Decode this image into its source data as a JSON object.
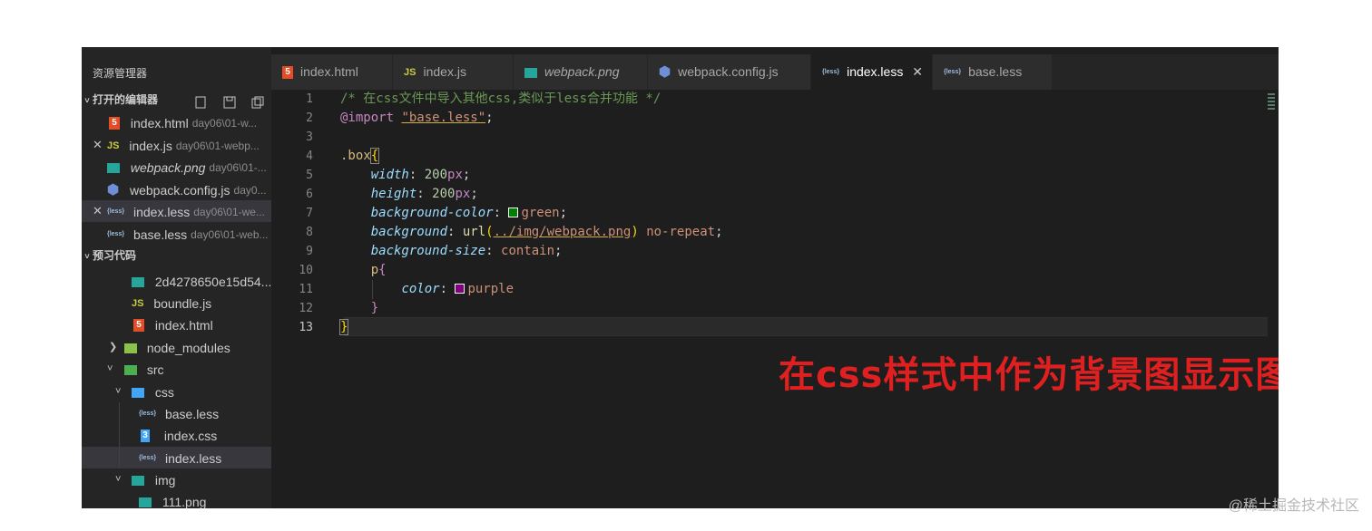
{
  "colors": {
    "html": "#e44d26",
    "js": "#cbcb41",
    "img": "#a074c4",
    "config": "#6d8fd5",
    "less": "#9cbde0",
    "css": "#42a5f5",
    "folder": "#8bc34a",
    "folder_src": "#4caf50",
    "folder_css": "#42a5f5",
    "overlay": "#e02020"
  },
  "sidebar": {
    "title": "资源管理器",
    "open_editors": {
      "header": "打开的编辑器",
      "items": [
        {
          "icon": "html-file-icon",
          "glyph": "5",
          "name": "index.html",
          "path": "day06\\01-w..."
        },
        {
          "icon": "js-file-icon",
          "glyph": "JS",
          "name": "index.js",
          "path": "day06\\01-webp..."
        },
        {
          "icon": "image-file-icon",
          "glyph": "▣",
          "name": "webpack.png",
          "path": "day06\\01-..."
        },
        {
          "icon": "webpack-config-icon",
          "glyph": "⬢",
          "name": "webpack.config.js",
          "path": "day0..."
        },
        {
          "icon": "less-file-icon",
          "glyph": "{less}",
          "name": "index.less",
          "path": "day06\\01-we..."
        },
        {
          "icon": "less-file-icon",
          "glyph": "{less}",
          "name": "base.less",
          "path": "day06\\01-web..."
        }
      ]
    },
    "project": {
      "header": "预习代码",
      "items": [
        {
          "icon": "image-file-icon",
          "name": "2d4278650e15d54..."
        },
        {
          "icon": "js-file-icon",
          "name": "boundle.js"
        },
        {
          "icon": "html-file-icon",
          "name": "index.html"
        },
        {
          "icon": "folder-icon",
          "name": "node_modules"
        },
        {
          "icon": "folder-icon",
          "name": "src"
        },
        {
          "icon": "folder-icon",
          "name": "css"
        },
        {
          "icon": "less-file-icon",
          "name": "base.less"
        },
        {
          "icon": "css-file-icon",
          "name": "index.css"
        },
        {
          "icon": "less-file-icon",
          "name": "index.less"
        },
        {
          "icon": "folder-icon",
          "name": "img"
        },
        {
          "icon": "image-file-icon",
          "name": "111.png"
        }
      ]
    }
  },
  "tabs": [
    {
      "label": "index.html",
      "icon": "html-file-icon"
    },
    {
      "label": "index.js",
      "icon": "js-file-icon"
    },
    {
      "label": "webpack.png",
      "icon": "image-file-icon"
    },
    {
      "label": "webpack.config.js",
      "icon": "webpack-config-icon"
    },
    {
      "label": "index.less",
      "icon": "less-file-icon",
      "active": true
    },
    {
      "label": "base.less",
      "icon": "less-file-icon"
    }
  ],
  "editor": {
    "line_numbers": [
      "1",
      "2",
      "3",
      "4",
      "5",
      "6",
      "7",
      "8",
      "9",
      "10",
      "11",
      "12",
      "13"
    ],
    "active_line": "13",
    "lines": {
      "l1": "/* 在css文件中导入其他css,类似于less合并功能 */",
      "l2_kw": "@import",
      "l2_str": "\"base.less\"",
      "l4_sel": ".box",
      "l5_prop": "width",
      "l5_num": "200",
      "l5_unit": "px",
      "l6_prop": "height",
      "l6_num": "200",
      "l6_unit": "px",
      "l7_prop": "background-color",
      "l7_val": "green",
      "l8_prop": "background",
      "l8_fn": "url",
      "l8_url": "../img/webpack.png",
      "l8_val": "no-repeat",
      "l9_prop": "background-size",
      "l9_val": "contain",
      "l10_sel": "p",
      "l11_prop": "color",
      "l11_val": "purple"
    },
    "swatch_green": "#008000",
    "swatch_purple": "#800080"
  },
  "annotation": "在css样式中作为背景图显示图片",
  "watermark": "@稀土掘金技术社区"
}
